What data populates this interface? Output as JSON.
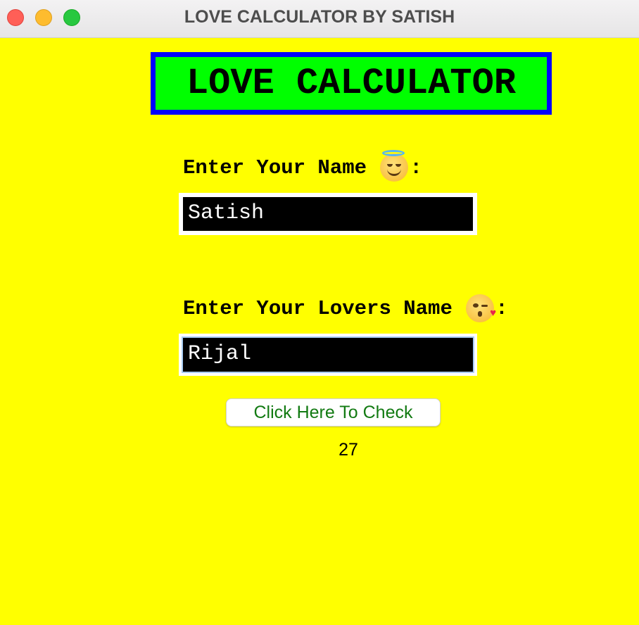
{
  "window": {
    "title": "LOVE CALCULATOR BY SATISH"
  },
  "banner": {
    "text": "LOVE CALCULATOR"
  },
  "form": {
    "your_name_label": "Enter Your Name",
    "your_name_emoji": "smiling-face-with-halo-icon",
    "your_name_suffix": ":",
    "your_name_value": "Satish",
    "lover_name_label": "Enter Your Lovers Name",
    "lover_name_emoji": "face-blowing-kiss-icon",
    "lover_name_suffix": ":",
    "lover_name_value": "Rijal",
    "check_button_label": "Click Here To Check",
    "result": "27"
  },
  "colors": {
    "background": "#ffff00",
    "banner_fill": "#00ff00",
    "banner_border": "#0000ff",
    "field_background": "#000000",
    "field_text": "#ffffff",
    "button_text": "#127a12"
  }
}
